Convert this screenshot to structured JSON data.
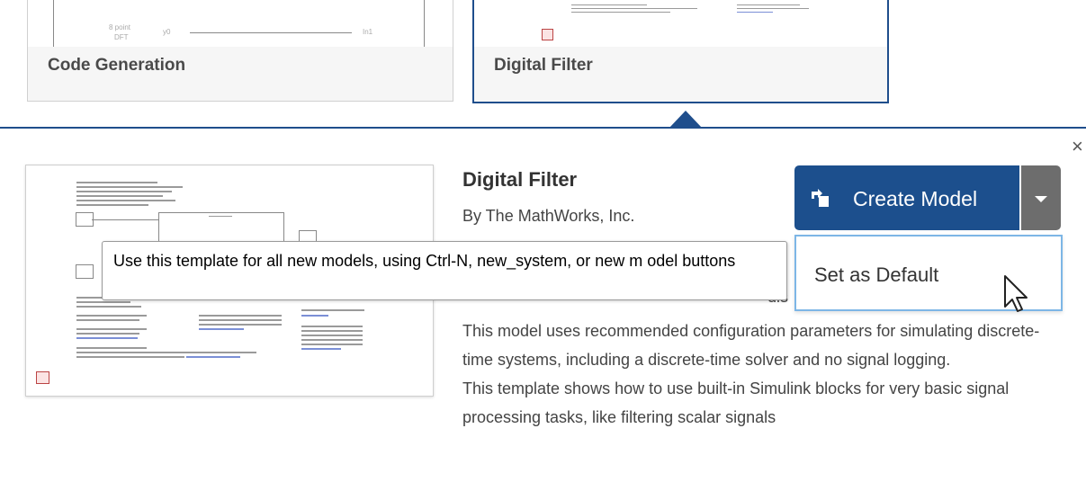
{
  "gallery": {
    "cards": [
      {
        "title": "Code Generation",
        "thumb_labels": [
          "8 point",
          "DFT",
          "y0",
          "In1"
        ]
      },
      {
        "title": "Digital Filter"
      }
    ]
  },
  "details": {
    "title": "Digital Filter",
    "author": "By The MathWorks, Inc.",
    "partial_text": "dis",
    "description": [
      "This model uses recommended configuration parameters for simulating discrete-time systems, including a discrete-time solver and no signal logging.",
      "This template shows how to use built-in Simulink blocks for very basic signal processing tasks, like filtering scalar signals"
    ]
  },
  "actions": {
    "create_model_label": "Create Model",
    "menu_item_label": "Set as Default"
  },
  "tooltip": {
    "text": "Use this template for all new models, using Ctrl-N, new_system, or new m odel buttons"
  },
  "close_label": "×",
  "colors": {
    "accent": "#1c4f8d",
    "split_gray": "#6d6d6d",
    "menu_border": "#7db6e6"
  }
}
